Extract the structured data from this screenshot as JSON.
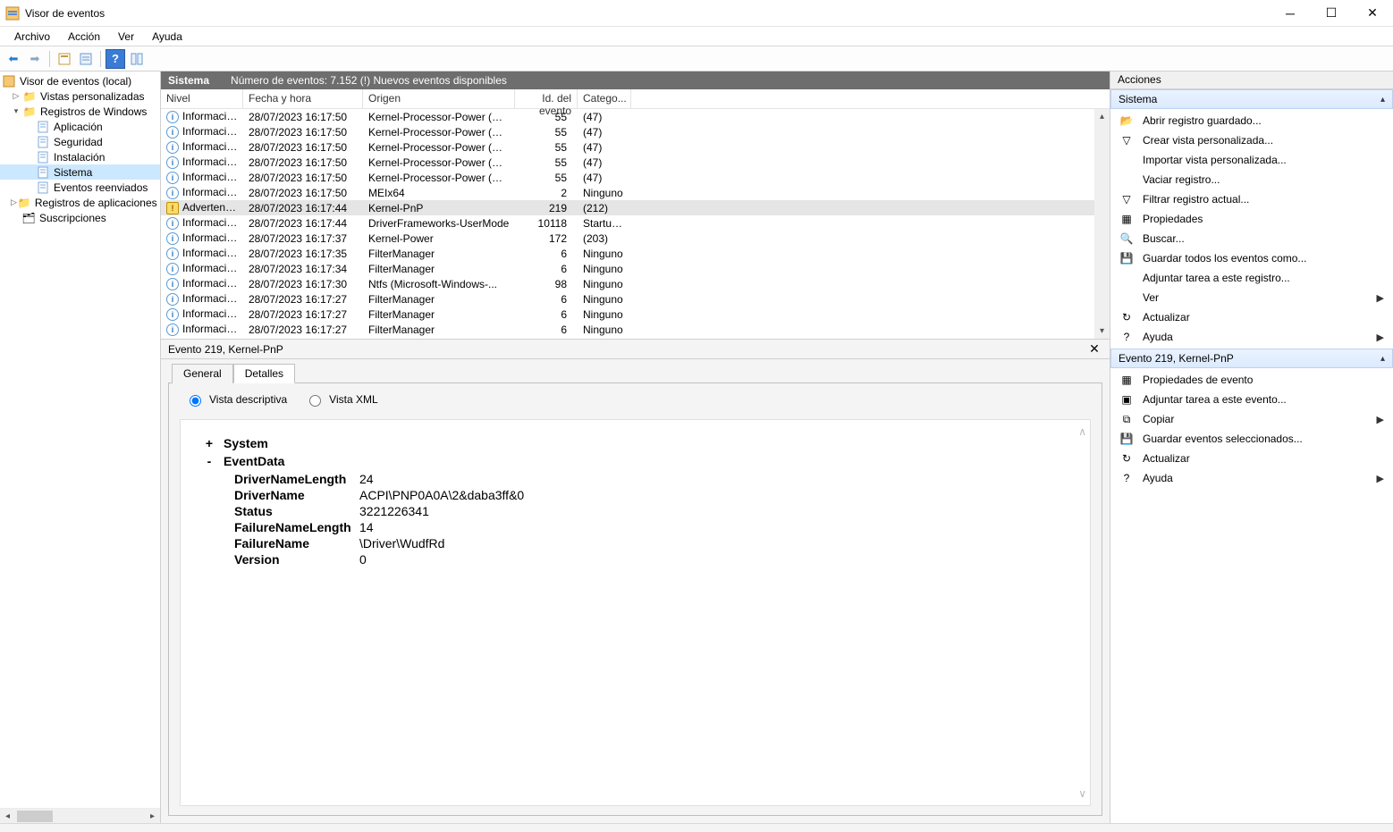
{
  "window": {
    "title": "Visor de eventos"
  },
  "menu": {
    "archivo": "Archivo",
    "accion": "Acción",
    "ver": "Ver",
    "ayuda": "Ayuda"
  },
  "tree": {
    "root": "Visor de eventos (local)",
    "vistas": "Vistas personalizadas",
    "regwin": "Registros de Windows",
    "aplicacion": "Aplicación",
    "seguridad": "Seguridad",
    "instalacion": "Instalación",
    "sistema": "Sistema",
    "reenv": "Eventos reenviados",
    "regapp": "Registros de aplicaciones y servicios",
    "susc": "Suscripciones"
  },
  "center": {
    "log_name": "Sistema",
    "summary": "Número de eventos: 7.152 (!) Nuevos eventos disponibles",
    "cols": {
      "level": "Nivel",
      "date": "Fecha y hora",
      "src": "Origen",
      "id": "Id. del evento",
      "cat": "Catego..."
    },
    "rows": [
      {
        "lvl": "info",
        "level": "Información",
        "date": "28/07/2023 16:17:50",
        "src": "Kernel-Processor-Power (M...",
        "id": "55",
        "cat": "(47)"
      },
      {
        "lvl": "info",
        "level": "Información",
        "date": "28/07/2023 16:17:50",
        "src": "Kernel-Processor-Power (M...",
        "id": "55",
        "cat": "(47)"
      },
      {
        "lvl": "info",
        "level": "Información",
        "date": "28/07/2023 16:17:50",
        "src": "Kernel-Processor-Power (M...",
        "id": "55",
        "cat": "(47)"
      },
      {
        "lvl": "info",
        "level": "Información",
        "date": "28/07/2023 16:17:50",
        "src": "Kernel-Processor-Power (M...",
        "id": "55",
        "cat": "(47)"
      },
      {
        "lvl": "info",
        "level": "Información",
        "date": "28/07/2023 16:17:50",
        "src": "Kernel-Processor-Power (M...",
        "id": "55",
        "cat": "(47)"
      },
      {
        "lvl": "info",
        "level": "Información",
        "date": "28/07/2023 16:17:50",
        "src": "MEIx64",
        "id": "2",
        "cat": "Ninguno"
      },
      {
        "lvl": "warn",
        "level": "Advertencia",
        "date": "28/07/2023 16:17:44",
        "src": "Kernel-PnP",
        "id": "219",
        "cat": "(212)",
        "selected": true
      },
      {
        "lvl": "info",
        "level": "Información",
        "date": "28/07/2023 16:17:44",
        "src": "DriverFrameworks-UserMode",
        "id": "10118",
        "cat": "Startup..."
      },
      {
        "lvl": "info",
        "level": "Información",
        "date": "28/07/2023 16:17:37",
        "src": "Kernel-Power",
        "id": "172",
        "cat": "(203)"
      },
      {
        "lvl": "info",
        "level": "Información",
        "date": "28/07/2023 16:17:35",
        "src": "FilterManager",
        "id": "6",
        "cat": "Ninguno"
      },
      {
        "lvl": "info",
        "level": "Información",
        "date": "28/07/2023 16:17:34",
        "src": "FilterManager",
        "id": "6",
        "cat": "Ninguno"
      },
      {
        "lvl": "info",
        "level": "Información",
        "date": "28/07/2023 16:17:30",
        "src": "Ntfs (Microsoft-Windows-...",
        "id": "98",
        "cat": "Ninguno"
      },
      {
        "lvl": "info",
        "level": "Información",
        "date": "28/07/2023 16:17:27",
        "src": "FilterManager",
        "id": "6",
        "cat": "Ninguno"
      },
      {
        "lvl": "info",
        "level": "Información",
        "date": "28/07/2023 16:17:27",
        "src": "FilterManager",
        "id": "6",
        "cat": "Ninguno"
      },
      {
        "lvl": "info",
        "level": "Información",
        "date": "28/07/2023 16:17:27",
        "src": "FilterManager",
        "id": "6",
        "cat": "Ninguno"
      }
    ]
  },
  "details": {
    "title": "Evento 219, Kernel-PnP",
    "tabs": {
      "general": "General",
      "detalles": "Detalles"
    },
    "view": {
      "descriptive": "Vista descriptiva",
      "xml": "Vista XML"
    },
    "nodes": {
      "system": "System",
      "eventdata": "EventData"
    },
    "kv": [
      {
        "k": "DriverNameLength",
        "v": "24"
      },
      {
        "k": "DriverName",
        "v": "ACPI\\PNP0A0A\\2&daba3ff&0"
      },
      {
        "k": "Status",
        "v": "3221226341"
      },
      {
        "k": "FailureNameLength",
        "v": "14"
      },
      {
        "k": "FailureName",
        "v": "\\Driver\\WudfRd"
      },
      {
        "k": "Version",
        "v": "0"
      }
    ]
  },
  "actions": {
    "title": "Acciones",
    "sec1_head": "Sistema",
    "sec1": [
      {
        "icon": "📂",
        "label": "Abrir registro guardado..."
      },
      {
        "icon": "▽",
        "label": "Crear vista personalizada..."
      },
      {
        "icon": "",
        "label": "Importar vista personalizada..."
      },
      {
        "icon": "",
        "label": "Vaciar registro..."
      },
      {
        "icon": "▽",
        "label": "Filtrar registro actual..."
      },
      {
        "icon": "▦",
        "label": "Propiedades"
      },
      {
        "icon": "🔍",
        "label": "Buscar..."
      },
      {
        "icon": "💾",
        "label": "Guardar todos los eventos como..."
      },
      {
        "icon": "",
        "label": "Adjuntar tarea a este registro..."
      },
      {
        "icon": "",
        "label": "Ver",
        "submenu": true
      },
      {
        "icon": "↻",
        "label": "Actualizar"
      },
      {
        "icon": "?",
        "label": "Ayuda",
        "submenu": true
      }
    ],
    "sec2_head": "Evento 219, Kernel-PnP",
    "sec2": [
      {
        "icon": "▦",
        "label": "Propiedades de evento"
      },
      {
        "icon": "▣",
        "label": "Adjuntar tarea a este evento..."
      },
      {
        "icon": "⧉",
        "label": "Copiar",
        "submenu": true
      },
      {
        "icon": "💾",
        "label": "Guardar eventos seleccionados..."
      },
      {
        "icon": "↻",
        "label": "Actualizar"
      },
      {
        "icon": "?",
        "label": "Ayuda",
        "submenu": true
      }
    ]
  }
}
